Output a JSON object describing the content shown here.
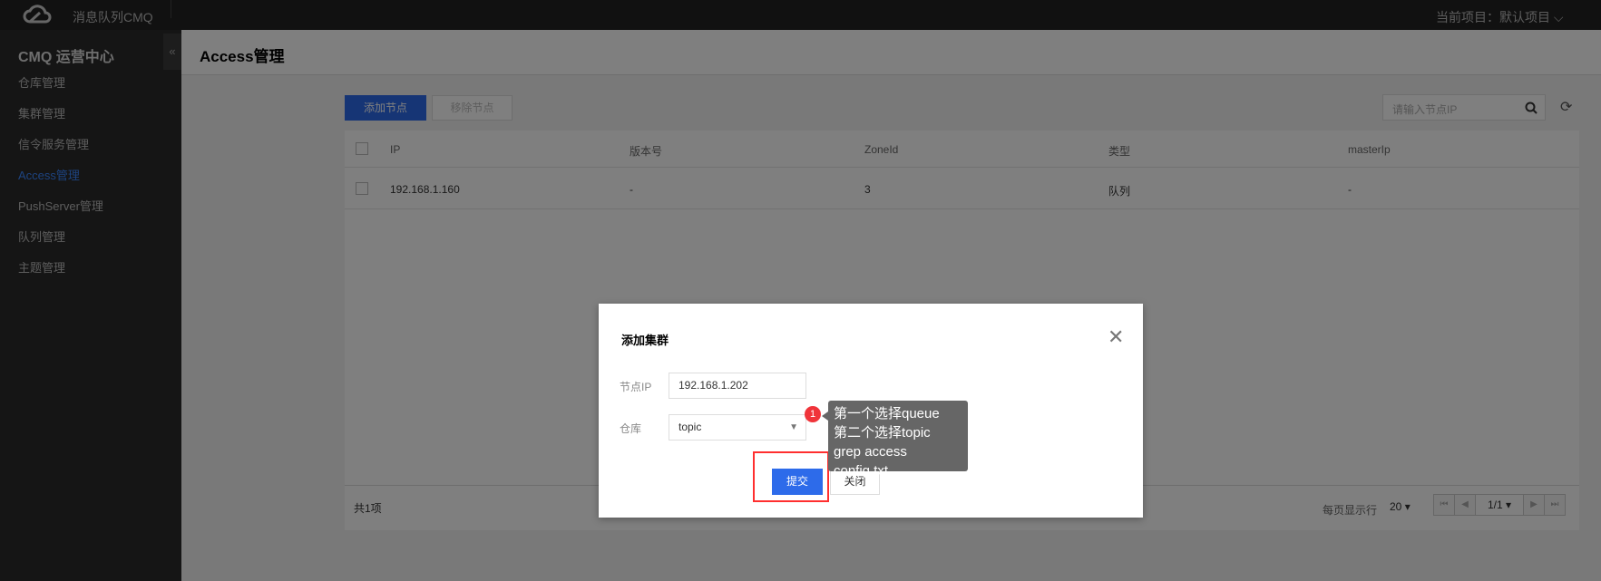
{
  "topbar": {
    "app_name": "消息队列CMQ",
    "project_label": "当前项目：默认项目"
  },
  "sidebar": {
    "title": "CMQ 运营中心",
    "collapse": "«",
    "items": [
      {
        "label": "仓库管理"
      },
      {
        "label": "集群管理"
      },
      {
        "label": "信令服务管理"
      },
      {
        "label": "Access管理",
        "active": true
      },
      {
        "label": "PushServer管理"
      },
      {
        "label": "队列管理"
      },
      {
        "label": "主题管理"
      }
    ]
  },
  "header": {
    "title": "Access管理"
  },
  "toolbar": {
    "add_label": "添加节点",
    "remove_label": "移除节点",
    "search_placeholder": "请输入节点IP"
  },
  "table": {
    "columns": [
      "IP",
      "版本号",
      "ZoneId",
      "类型",
      "masterIp"
    ],
    "rows": [
      [
        "192.168.1.160",
        "-",
        "3",
        "队列",
        "-"
      ]
    ]
  },
  "footer": {
    "total": "共1项",
    "per_page_label": "每页显示行",
    "per_page": "20",
    "page": "1/1"
  },
  "modal": {
    "title": "添加集群",
    "ip_label": "节点IP",
    "ip_value": "192.168.1.202",
    "repo_label": "仓库",
    "repo_value": "topic",
    "submit": "提交",
    "close": "关闭"
  },
  "annotation": {
    "badge": "1",
    "lines": [
      "第一个选择queue",
      "第二个选择topic",
      "grep access config.txt"
    ]
  },
  "colors": {
    "accent": "#2d6bea",
    "highlight": "#ff2f2f"
  }
}
